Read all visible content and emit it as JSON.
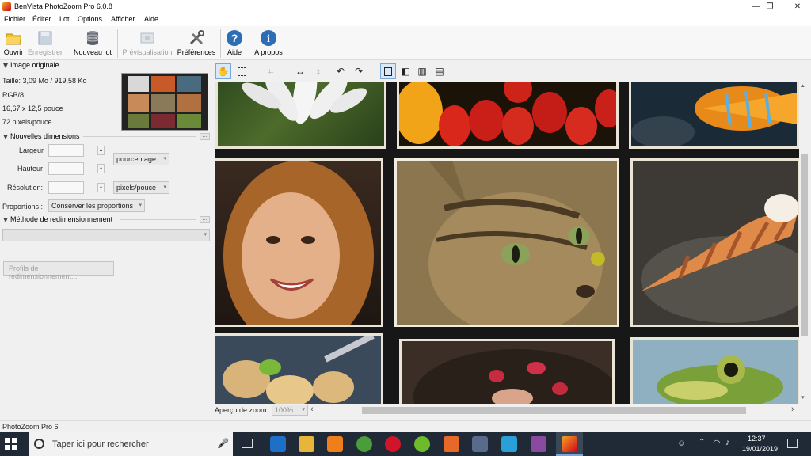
{
  "window": {
    "title": "BenVista PhotoZoom Pro 6.0.8",
    "minimize_glyph": "—",
    "maximize_glyph": "❐",
    "close_glyph": "✕"
  },
  "menu": [
    "Fichier",
    "Éditer",
    "Lot",
    "Options",
    "Afficher",
    "Aide"
  ],
  "toolbar": {
    "open": "Ouvrir",
    "save": "Enregistrer",
    "new_batch": "Nouveau lot",
    "preview": "Prévisualisation",
    "preferences": "Préférences",
    "help": "Aide",
    "about": "A propos"
  },
  "original_image": {
    "header": "Image originale",
    "size": "Taille: 3,09 Mo / 919,58 Ko",
    "mode": "RGB/8",
    "dimensions": "16,67 x 12,5 pouce",
    "resolution": "72 pixels/pouce"
  },
  "new_dimensions": {
    "header": "Nouvelles dimensions",
    "width_label": "Largeur",
    "height_label": "Hauteur",
    "resolution_label": "Résolution:",
    "unit_size": "pourcentage",
    "unit_resolution": "pixels/pouce",
    "proportions_label": "Proportions :",
    "proportions_value": "Conserver les proportions",
    "dots": "..."
  },
  "resize_method": {
    "header": "Méthode de redimensionnement",
    "profiles_button": "Profils de redimensionnement..."
  },
  "viewer": {
    "zoom_label": "Aperçu de zoom :",
    "zoom_value": "100%",
    "left_arrow": "‹",
    "right_arrow": "›"
  },
  "status": {
    "text": "PhotoZoom Pro 6"
  },
  "taskbar": {
    "search_placeholder": "Taper ici pour rechercher",
    "time": "12:37",
    "date": "19/01/2019"
  },
  "colors": {
    "accent_blue": "#2d6db5",
    "taskbar_bg": "#1f2a36",
    "photo_frame": "#e9e4d6"
  }
}
